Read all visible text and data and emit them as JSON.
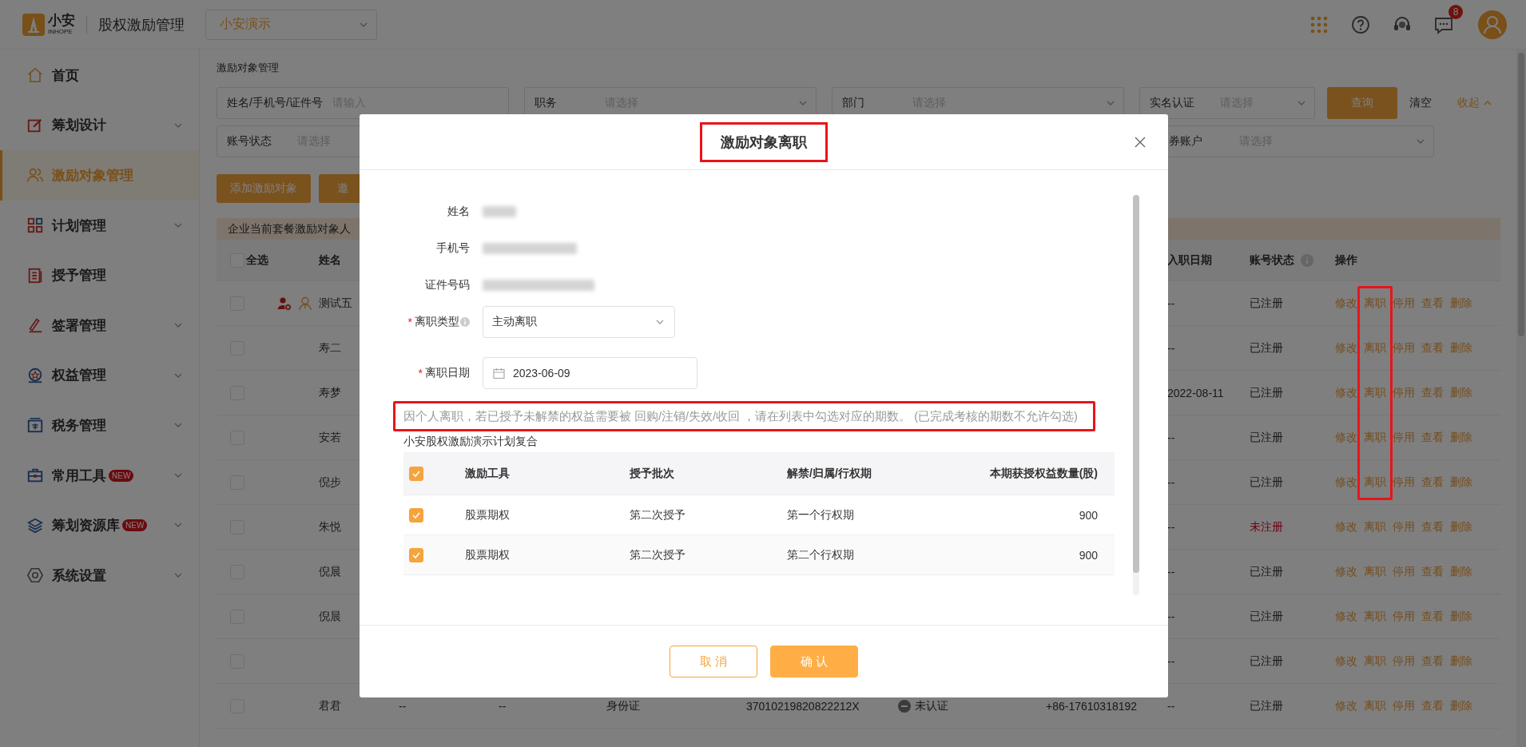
{
  "header": {
    "logo_text": "小安",
    "logo_subtext": "INHOPE",
    "app_title": "股权激励管理",
    "company_select": {
      "value": "小安演示"
    },
    "notification_count": "8"
  },
  "sidebar": {
    "items": [
      {
        "label": "首页",
        "expandable": false,
        "selected": false
      },
      {
        "label": "筹划设计",
        "expandable": true,
        "selected": false
      },
      {
        "label": "激励对象管理",
        "expandable": false,
        "selected": true
      },
      {
        "label": "计划管理",
        "expandable": true,
        "selected": false
      },
      {
        "label": "授予管理",
        "expandable": false,
        "selected": false
      },
      {
        "label": "签署管理",
        "expandable": true,
        "selected": false
      },
      {
        "label": "权益管理",
        "expandable": true,
        "selected": false
      },
      {
        "label": "税务管理",
        "expandable": true,
        "selected": false
      },
      {
        "label": "常用工具",
        "badge": "NEW",
        "expandable": true,
        "selected": false
      },
      {
        "label": "筹划资源库",
        "badge": "NEW",
        "expandable": true,
        "selected": false
      },
      {
        "label": "系统设置",
        "expandable": true,
        "selected": false
      }
    ]
  },
  "breadcrumb": "激励对象管理",
  "filters": {
    "fields": [
      {
        "label": "姓名/手机号/证件号",
        "placeholder": "请输入",
        "kind": "input"
      },
      {
        "label": "职务",
        "placeholder": "请选择",
        "kind": "select"
      },
      {
        "label": "部门",
        "placeholder": "请选择",
        "kind": "select"
      },
      {
        "label": "实名认证",
        "placeholder": "请选择",
        "kind": "select"
      },
      {
        "label": "账号状态",
        "placeholder": "请选择",
        "kind": "select"
      },
      {
        "label": "券账户",
        "placeholder": "请选择",
        "kind": "select"
      }
    ],
    "query_button": "查询",
    "clear_link": "清空",
    "collapse_link": "收起"
  },
  "toolbar": {
    "buttons": [
      {
        "label": "添加激励对象"
      },
      {
        "label": "邀"
      }
    ]
  },
  "notice": "企业当前套餐激励对象人",
  "table": {
    "select_all": {
      "label": "全选",
      "checked": false
    },
    "columns": {
      "name": "姓名",
      "entry_date": "入职日期",
      "account_status": "账号状态",
      "actions": "操作"
    },
    "rows": [
      {
        "checked": false,
        "status_icons": true,
        "name": "测试五",
        "entry_date": "--",
        "account_status": "已注册",
        "registered": true,
        "resign_highlighted": true,
        "actions": [
          "修改",
          "离职",
          "停用",
          "查看",
          "删除"
        ]
      },
      {
        "checked": false,
        "status_icons": false,
        "name": "寿二",
        "entry_date": "--",
        "account_status": "已注册",
        "registered": true,
        "resign_highlighted": true,
        "actions": [
          "修改",
          "离职",
          "停用",
          "查看",
          "删除"
        ]
      },
      {
        "checked": false,
        "status_icons": false,
        "name": "寿梦",
        "entry_date": "2022-08-11",
        "account_status": "已注册",
        "registered": true,
        "resign_highlighted": true,
        "actions": [
          "修改",
          "离职",
          "停用",
          "查看",
          "删除"
        ]
      },
      {
        "checked": false,
        "status_icons": false,
        "name": "安若",
        "entry_date": "--",
        "account_status": "已注册",
        "registered": true,
        "resign_highlighted": true,
        "actions": [
          "修改",
          "离职",
          "停用",
          "查看",
          "删除"
        ]
      },
      {
        "checked": false,
        "status_icons": false,
        "name": "倪步",
        "entry_date": "--",
        "account_status": "已注册",
        "registered": true,
        "resign_highlighted": true,
        "actions": [
          "修改",
          "离职",
          "停用",
          "查看",
          "删除"
        ]
      },
      {
        "checked": false,
        "status_icons": false,
        "name": "朱悦",
        "entry_date": "--",
        "account_status": "未注册",
        "registered": false,
        "resign_highlighted": false,
        "actions": [
          "修改",
          "离职",
          "停用",
          "查看",
          "删除"
        ]
      },
      {
        "checked": false,
        "status_icons": false,
        "name": "倪晨",
        "entry_date": "--",
        "account_status": "已注册",
        "registered": true,
        "resign_highlighted": false,
        "actions": [
          "修改",
          "离职",
          "停用",
          "查看",
          "删除"
        ]
      },
      {
        "checked": false,
        "status_icons": false,
        "name": "倪晨",
        "entry_date": "--",
        "account_status": "已注册",
        "registered": true,
        "resign_highlighted": false,
        "actions": [
          "修改",
          "离职",
          "停用",
          "查看",
          "删除"
        ]
      },
      {
        "checked": false,
        "status_icons": false,
        "entry_date": "--",
        "account_status": "已注册",
        "registered": true,
        "resign_highlighted": false,
        "actions": [
          "修改",
          "离职",
          "停用",
          "查看",
          "删除"
        ]
      },
      {
        "checked": false,
        "status_icons": false,
        "name": "君君",
        "details": {
          "column_3": "--",
          "column_4": "--",
          "id_type": "身份证",
          "id_number": "37010219820822212X",
          "verification": "未认证",
          "verified": false,
          "phone": "+86-17610318192"
        },
        "entry_date": "--",
        "account_status": "已注册",
        "registered": true,
        "resign_highlighted": false,
        "actions": [
          "修改",
          "离职",
          "停用",
          "查看",
          "删除"
        ]
      }
    ]
  },
  "modal": {
    "title": "激励对象离职",
    "title_highlighted": true,
    "fields": [
      {
        "label": "姓名",
        "kind": "redacted",
        "info": false
      },
      {
        "label": "手机号",
        "kind": "redacted",
        "info": false
      },
      {
        "label": "证件号码",
        "kind": "redacted",
        "info": false
      },
      {
        "label": "离职类型",
        "kind": "select",
        "value": "主动离职",
        "required_mark": "*",
        "info": true
      },
      {
        "label": "离职日期",
        "kind": "date",
        "value": "2023-06-09",
        "required_mark": "*",
        "info": false
      }
    ],
    "notice": "因个人离职，若已授予未解禁的权益需要被 回购/注销/失效/收回 ，请在列表中勾选对应的期数。 (已完成考核的期数不允许勾选)",
    "notice_highlighted": true,
    "plan_title": "小安股权激励演示计划复合",
    "table": {
      "all_checked": true,
      "columns": [
        "激励工具",
        "授予批次",
        "解禁/归属/行权期",
        "本期获授权益数量(股)"
      ],
      "rows": [
        {
          "checked": true,
          "cells": [
            "股票期权",
            "第二次授予",
            "第一个行权期",
            "900"
          ]
        },
        {
          "checked": true,
          "cells": [
            "股票期权",
            "第二次授予",
            "第二个行权期",
            "900"
          ]
        }
      ]
    },
    "buttons": [
      {
        "label": "取 消",
        "kind": "secondary"
      },
      {
        "label": "确 认",
        "kind": "primary"
      }
    ]
  }
}
